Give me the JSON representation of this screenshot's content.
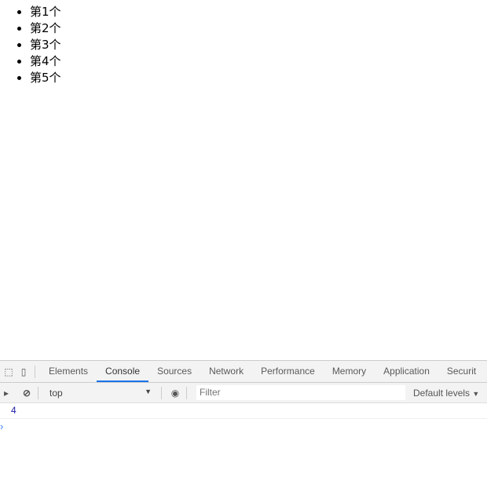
{
  "list": [
    "第1个",
    "第2个",
    "第3个",
    "第4个",
    "第5个"
  ],
  "devtools": {
    "tabs": [
      "Elements",
      "Console",
      "Sources",
      "Network",
      "Performance",
      "Memory",
      "Application",
      "Securit"
    ],
    "active_tab": "Console",
    "context": "top",
    "filter_placeholder": "Filter",
    "levels": "Default levels",
    "output": [
      "4"
    ],
    "prompt": "›"
  }
}
